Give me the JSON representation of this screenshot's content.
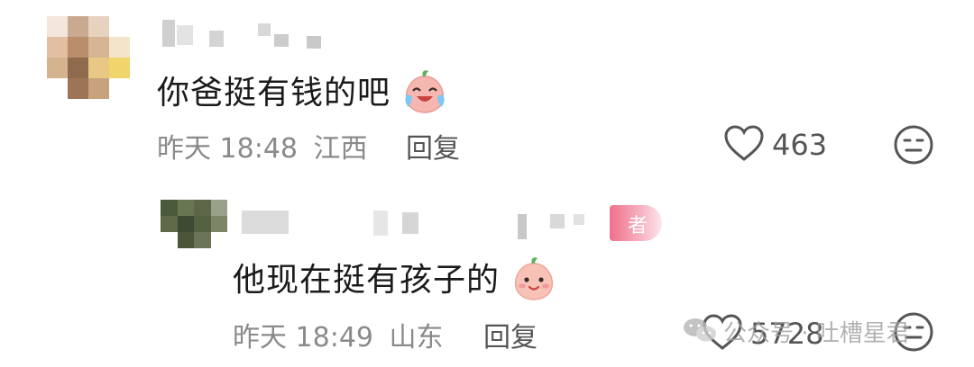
{
  "comment1": {
    "text": "你爸挺有钱的吧",
    "time": "昨天 18:48",
    "location": "江西",
    "reply_label": "回复",
    "like_count": "463"
  },
  "comment2": {
    "text": "他现在挺有孩子的",
    "time": "昨天 18:49",
    "location": "山东",
    "reply_label": "回复",
    "like_count": "5728"
  },
  "author_tag": "者",
  "watermark": {
    "text": "公众号 · 吐槽星君"
  },
  "icons": {
    "like": "heart-outline-icon",
    "dislike": "neutral-face-icon",
    "emoji1": "crying-laughing-peach-emoji",
    "emoji2": "smiling-peach-emoji",
    "wechat": "wechat-logo-icon"
  }
}
